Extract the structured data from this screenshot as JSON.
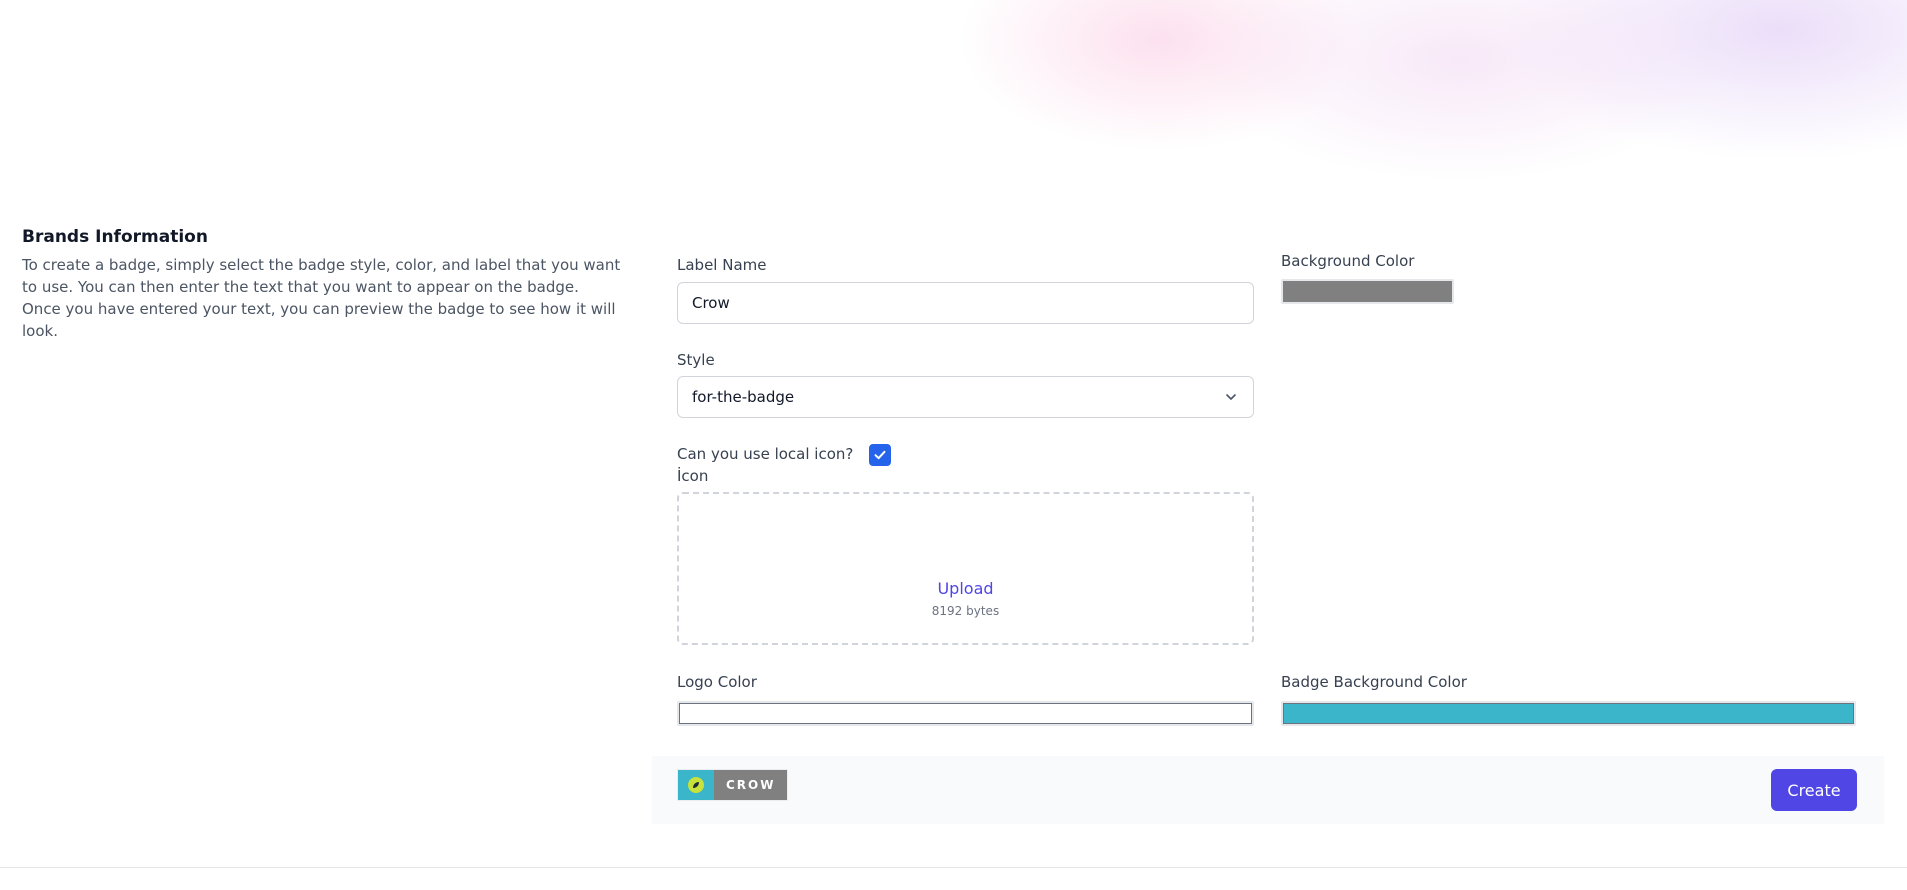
{
  "info": {
    "title": "Brands Information",
    "description": "To create a badge, simply select the badge style, color, and label that you want to use. You can then enter the text that you want to appear on the badge. Once you have entered your text, you can preview the badge to see how it will look."
  },
  "form": {
    "label_name": {
      "label": "Label Name",
      "value": "Crow"
    },
    "background_color": {
      "label": "Background Color",
      "value": "#808080"
    },
    "style": {
      "label": "Style",
      "selected": "for-the-badge"
    },
    "local_icon": {
      "label": "Can you use local icon?",
      "checked": true
    },
    "icon": {
      "label": "İcon",
      "upload_label": "Upload",
      "size_text": "8192 bytes"
    },
    "logo_color": {
      "label": "Logo Color",
      "value": "#ffffff"
    },
    "badge_background_color": {
      "label": "Badge Background Color",
      "value": "#3ab5c9"
    }
  },
  "preview": {
    "badge_text": "CROW",
    "badge_icon_color": "#3ab5c9",
    "badge_label_color": "#808080"
  },
  "actions": {
    "create_label": "Create"
  },
  "colors": {
    "primary": "#4f46e5",
    "checkbox": "#2563eb"
  },
  "icons": {
    "chevron": "chevron-down-icon",
    "check": "check-icon",
    "badge_logo": "leaf-logo-icon"
  }
}
